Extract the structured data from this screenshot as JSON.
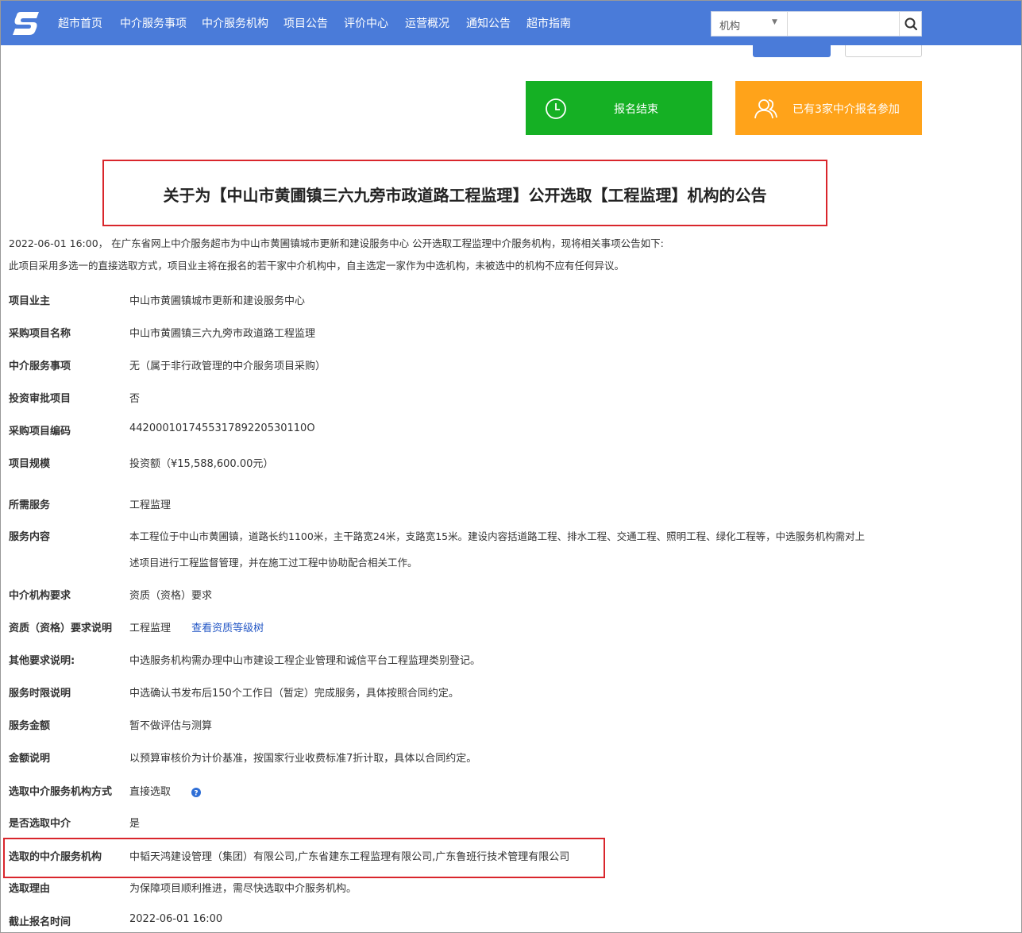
{
  "nav": {
    "items": [
      "超市首页",
      "中介服务事项",
      "中介服务机构",
      "项目公告",
      "评价中心",
      "运营概况",
      "通知公告",
      "超市指南"
    ],
    "search": {
      "category": "机构",
      "placeholder": ""
    }
  },
  "status": {
    "registration": "报名结束",
    "participants": "已有3家中介报名参加"
  },
  "title": "关于为【中山市黄圃镇三六九旁市政道路工程监理】公开选取【工程监理】机构的公告",
  "intro": {
    "line1": "2022-06-01 16:00， 在广东省网上中介服务超市为中山市黄圃镇城市更新和建设服务中心 公开选取工程监理中介服务机构，现将相关事项公告如下:",
    "line2": "此项目采用多选一的直接选取方式，项目业主将在报名的若干家中介机构中，自主选定一家作为中选机构，未被选中的机构不应有任何异议。"
  },
  "details": [
    {
      "label": "项目业主",
      "value": "中山市黄圃镇城市更新和建设服务中心"
    },
    {
      "label": "采购项目名称",
      "value": "中山市黄圃镇三六九旁市政道路工程监理"
    },
    {
      "label": "中介服务事项",
      "value": "无（属于非行政管理的中介服务项目采购）"
    },
    {
      "label": "投资审批项目",
      "value": "否"
    },
    {
      "label": "采购项目编码",
      "value": "442000101745531789220530110O"
    },
    {
      "label": "项目规模",
      "value": "投资额（¥15,588,600.00元）"
    },
    {
      "label": "所需服务",
      "value": "工程监理"
    },
    {
      "label": "服务内容",
      "value": "本工程位于中山市黄圃镇，道路长约1100米，主干路宽24米，支路宽15米。建设内容括道路工程、排水工程、交通工程、照明工程、绿化工程等，中选服务机构需对上",
      "value2": "述项目进行工程监督管理，并在施工过工程中协助配合相关工作。"
    },
    {
      "label": "中介机构要求",
      "value": "资质（资格）要求"
    },
    {
      "label": "资质（资格）要求说明",
      "value": "工程监理",
      "link": "查看资质等级树"
    },
    {
      "label": "其他要求说明:",
      "value": "中选服务机构需办理中山市建设工程企业管理和诚信平台工程监理类别登记。"
    },
    {
      "label": "服务时限说明",
      "value": "中选确认书发布后150个工作日（暂定）完成服务，具体按照合同约定。"
    },
    {
      "label": "服务金额",
      "value": "暂不做评估与测算"
    },
    {
      "label": "金额说明",
      "value": "以预算审核价为计价基准，按国家行业收费标准7折计取，具体以合同约定。"
    },
    {
      "label": "选取中介服务机构方式",
      "value": "直接选取"
    },
    {
      "label": "是否选取中介",
      "value": "是"
    },
    {
      "label": "选取的中介服务机构",
      "value": "中韬天鸿建设管理（集团）有限公司,广东省建东工程监理有限公司,广东鲁班行技术管理有限公司"
    },
    {
      "label": "选取理由",
      "value": "为保障项目顺利推进，需尽快选取中介服务机构。"
    },
    {
      "label": "截止报名时间",
      "value": "2022-06-01 16:00"
    }
  ],
  "colors": {
    "nav": "#4a7bd9",
    "green": "#15b024",
    "orange": "#ffa31a",
    "highlight": "#d9262c",
    "link": "#2457c5"
  },
  "icons": {
    "logo": "site-logo",
    "search": "search-icon",
    "clock": "clock-icon",
    "users": "users-icon",
    "help": "help-icon"
  }
}
